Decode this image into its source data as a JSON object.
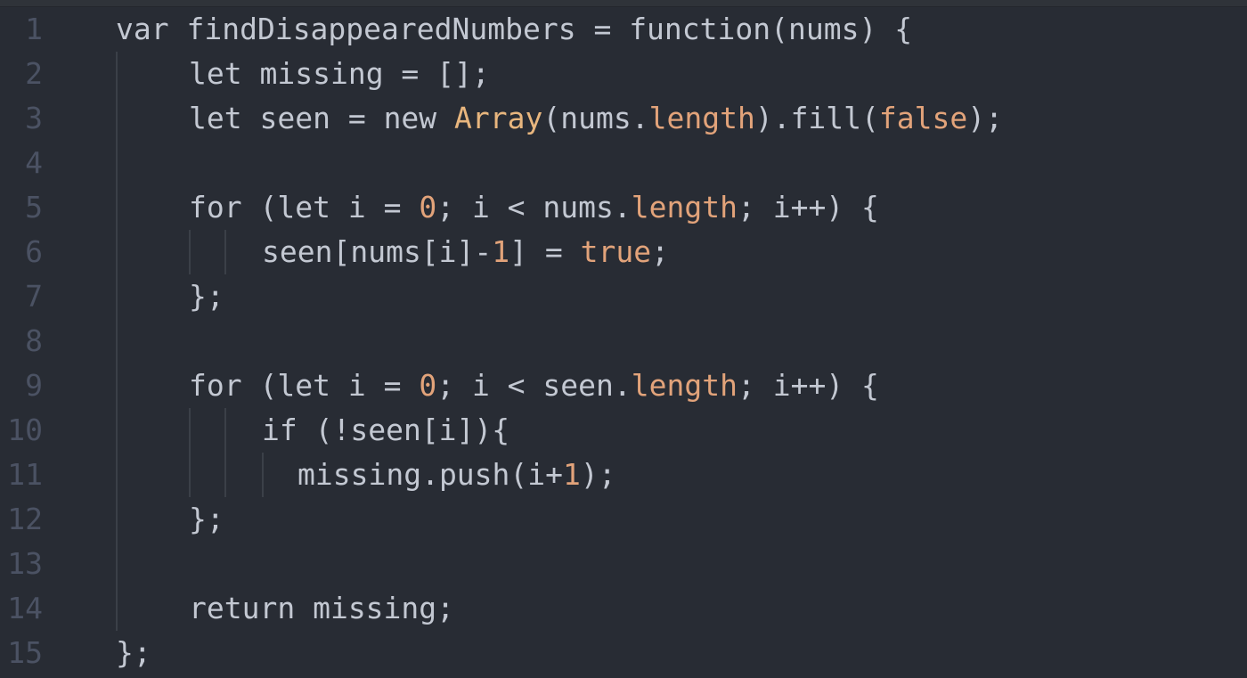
{
  "editor": {
    "lines": [
      {
        "number": "1",
        "tokens": [
          {
            "t": "var ",
            "c": "kw"
          },
          {
            "t": "findDisappearedNumbers",
            "c": "plain"
          },
          {
            "t": " = ",
            "c": "plain"
          },
          {
            "t": "function",
            "c": "kw"
          },
          {
            "t": "(nums) {",
            "c": "plain"
          }
        ]
      },
      {
        "number": "2",
        "tokens": [
          {
            "t": "let ",
            "c": "kw"
          },
          {
            "t": "missing = [];",
            "c": "plain"
          }
        ]
      },
      {
        "number": "3",
        "tokens": [
          {
            "t": "let ",
            "c": "kw"
          },
          {
            "t": "seen = ",
            "c": "plain"
          },
          {
            "t": "new ",
            "c": "kw"
          },
          {
            "t": "Array",
            "c": "cls"
          },
          {
            "t": "(nums.",
            "c": "plain"
          },
          {
            "t": "length",
            "c": "prop"
          },
          {
            "t": ").fill(",
            "c": "plain"
          },
          {
            "t": "false",
            "c": "bool"
          },
          {
            "t": ");",
            "c": "plain"
          }
        ]
      },
      {
        "number": "4",
        "tokens": []
      },
      {
        "number": "5",
        "tokens": [
          {
            "t": "for ",
            "c": "kw"
          },
          {
            "t": "(",
            "c": "plain"
          },
          {
            "t": "let ",
            "c": "kw"
          },
          {
            "t": "i = ",
            "c": "plain"
          },
          {
            "t": "0",
            "c": "num"
          },
          {
            "t": "; i < nums.",
            "c": "plain"
          },
          {
            "t": "length",
            "c": "prop"
          },
          {
            "t": "; i++) {",
            "c": "plain"
          }
        ]
      },
      {
        "number": "6",
        "tokens": [
          {
            "t": "seen[nums[i]-",
            "c": "plain"
          },
          {
            "t": "1",
            "c": "num"
          },
          {
            "t": "] = ",
            "c": "plain"
          },
          {
            "t": "true",
            "c": "bool"
          },
          {
            "t": ";",
            "c": "plain"
          }
        ]
      },
      {
        "number": "7",
        "tokens": [
          {
            "t": "};",
            "c": "plain"
          }
        ]
      },
      {
        "number": "8",
        "tokens": []
      },
      {
        "number": "9",
        "tokens": [
          {
            "t": "for ",
            "c": "kw"
          },
          {
            "t": "(",
            "c": "plain"
          },
          {
            "t": "let ",
            "c": "kw"
          },
          {
            "t": "i = ",
            "c": "plain"
          },
          {
            "t": "0",
            "c": "num"
          },
          {
            "t": "; i < seen.",
            "c": "plain"
          },
          {
            "t": "length",
            "c": "prop"
          },
          {
            "t": "; i++) {",
            "c": "plain"
          }
        ]
      },
      {
        "number": "10",
        "tokens": [
          {
            "t": "if ",
            "c": "kw"
          },
          {
            "t": "(!seen[i]){",
            "c": "plain"
          }
        ]
      },
      {
        "number": "11",
        "tokens": [
          {
            "t": "missing.push(i+",
            "c": "plain"
          },
          {
            "t": "1",
            "c": "num"
          },
          {
            "t": ");",
            "c": "plain"
          }
        ]
      },
      {
        "number": "12",
        "tokens": [
          {
            "t": "};",
            "c": "plain"
          }
        ]
      },
      {
        "number": "13",
        "tokens": []
      },
      {
        "number": "14",
        "tokens": [
          {
            "t": "return ",
            "c": "kw"
          },
          {
            "t": "missing;",
            "c": "plain"
          }
        ]
      },
      {
        "number": "15",
        "tokens": [
          {
            "t": "};",
            "c": "plain"
          }
        ]
      }
    ],
    "colors": {
      "background": "#282c34",
      "gutter_text": "#4b5263",
      "text": "#c3c8d2",
      "number_literal": "#e2a37a",
      "class_name": "#e8b67e",
      "indent_guide": "#3b4048"
    }
  }
}
